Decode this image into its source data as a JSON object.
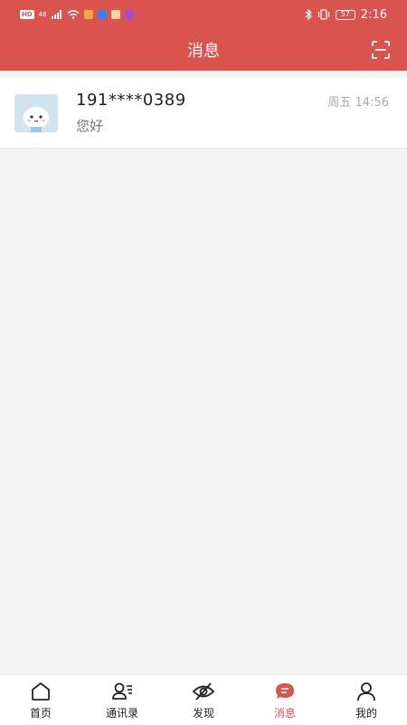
{
  "status_bar": {
    "hd_label": "HD",
    "signal_label": "46",
    "battery": "57",
    "time": "2:16"
  },
  "header": {
    "title": "消息",
    "scan_icon": "scan-icon"
  },
  "conversations": [
    {
      "name": "191****0389",
      "last_message": "您好",
      "time": "周五 14:56",
      "avatar_icon": "avatar-face-icon"
    }
  ],
  "tabbar": {
    "items": [
      {
        "label": "首页",
        "icon": "home-icon",
        "active": false
      },
      {
        "label": "通讯录",
        "icon": "contacts-icon",
        "active": false
      },
      {
        "label": "发现",
        "icon": "discover-icon",
        "active": false
      },
      {
        "label": "消息",
        "icon": "message-icon",
        "active": true
      },
      {
        "label": "我的",
        "icon": "profile-icon",
        "active": false
      }
    ]
  },
  "colors": {
    "brand": "#d9534f",
    "background": "#f4f4f4"
  }
}
